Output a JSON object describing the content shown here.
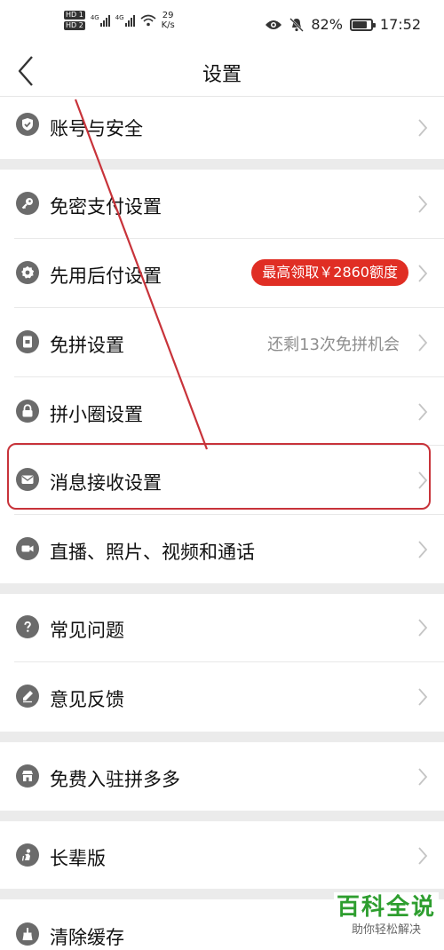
{
  "status_bar": {
    "hd1": "HD 1",
    "hd2": "HD 2",
    "net1": "4G",
    "net2": "4G",
    "speed_value": "29",
    "speed_unit": "K/s",
    "battery": "82%",
    "battery_level": 0.82,
    "time": "17:52",
    "icons": [
      "eye-icon",
      "mute-bell-icon",
      "battery-icon",
      "wifi-icon"
    ]
  },
  "header": {
    "title": "设置",
    "back_icon": "chevron-left-icon"
  },
  "settings": {
    "account_security": {
      "label": "账号与安全",
      "icon": "shield-check-icon"
    },
    "password_free_pay": {
      "label": "免密支付设置",
      "icon": "key-icon"
    },
    "pay_later": {
      "label": "先用后付设置",
      "icon": "gear-badge-icon",
      "badge": "最高领取￥2860额度"
    },
    "free_group": {
      "label": "免拼设置",
      "icon": "card-icon",
      "hint": "还剩13次免拼机会"
    },
    "circle": {
      "label": "拼小圈设置",
      "icon": "lock-icon"
    },
    "message": {
      "label": "消息接收设置",
      "icon": "mail-icon"
    },
    "media": {
      "label": "直播、照片、视频和通话",
      "icon": "video-camera-icon"
    },
    "faq": {
      "label": "常见问题",
      "icon": "question-icon"
    },
    "feedback": {
      "label": "意见反馈",
      "icon": "pencil-icon"
    },
    "merchant": {
      "label": "免费入驻拼多多",
      "icon": "store-icon"
    },
    "elder_mode": {
      "label": "长辈版",
      "icon": "elder-icon"
    },
    "clear_cache": {
      "label": "清除缓存",
      "icon": "broom-icon"
    }
  },
  "watermark": {
    "title": "百科全说",
    "subtitle": "助你轻松解决"
  },
  "colors": {
    "accent_red": "#e02e24",
    "highlight_red": "#c8333a",
    "icon_gray": "#6b6b6b",
    "section_gap": "#ebebeb",
    "watermark_green": "#2e9e2f"
  }
}
